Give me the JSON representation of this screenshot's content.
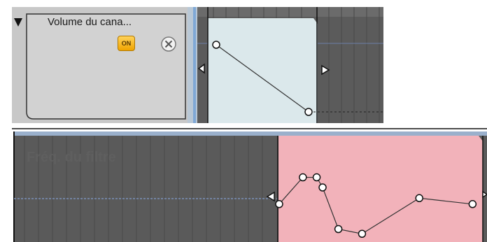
{
  "top_track": {
    "label": "Volume du cana...",
    "on_badge": "ON",
    "icons": [
      "disclosure-triangle-icon",
      "close-icon"
    ],
    "region_color": "#dbe8eb",
    "automation_points": [
      {
        "t": 0.0,
        "v": 1.0
      },
      {
        "t": 1.0,
        "v": 0.0
      }
    ]
  },
  "bottom_track": {
    "label": "Fréq. du filtre",
    "region_color": "#f2b2ba",
    "automation_points": [
      {
        "t": 0.0,
        "v": 0.52
      },
      {
        "t": 0.12,
        "v": 0.97
      },
      {
        "t": 0.19,
        "v": 0.97
      },
      {
        "t": 0.22,
        "v": 0.8
      },
      {
        "t": 0.3,
        "v": 0.1
      },
      {
        "t": 0.42,
        "v": 0.02
      },
      {
        "t": 0.71,
        "v": 0.62
      },
      {
        "t": 0.98,
        "v": 0.52
      }
    ]
  }
}
